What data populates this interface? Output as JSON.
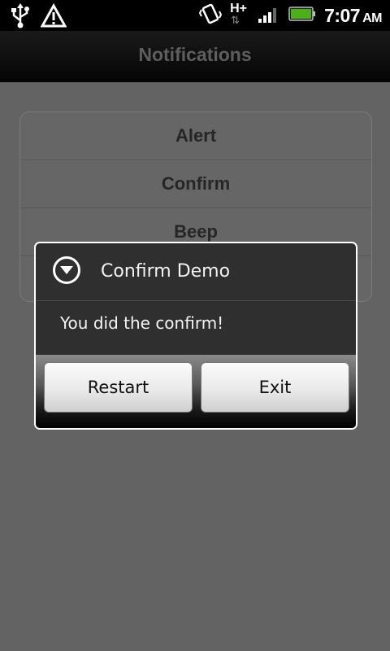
{
  "status_bar": {
    "icons": [
      "usb-icon",
      "warning-icon",
      "vibrate-icon",
      "hplus-network-icon",
      "signal-icon",
      "battery-icon"
    ],
    "network_label": "H+",
    "time": "7:07",
    "ampm": "AM",
    "battery_color": "#4caf1a"
  },
  "app": {
    "title": "Notifications"
  },
  "list": {
    "items": [
      {
        "label": "Alert"
      },
      {
        "label": "Confirm"
      },
      {
        "label": "Beep"
      },
      {
        "label": ""
      }
    ]
  },
  "dialog": {
    "icon": "dropdown-circle-icon",
    "title": "Confirm Demo",
    "message": "You did the confirm!",
    "buttons": {
      "restart": "Restart",
      "exit": "Exit"
    }
  }
}
